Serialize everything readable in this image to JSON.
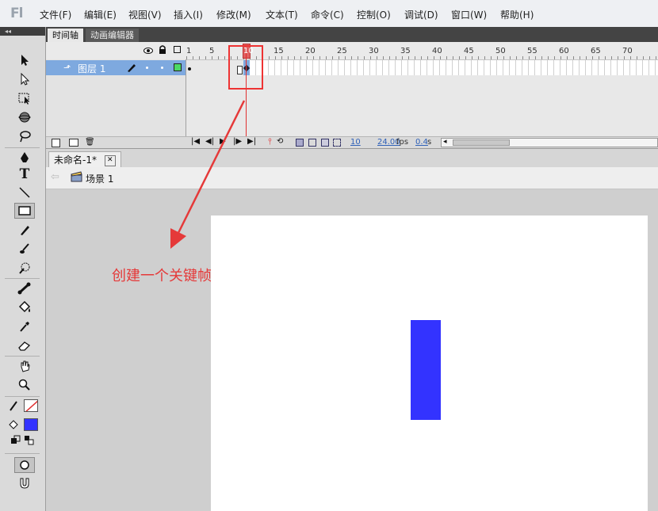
{
  "app": {
    "logo": "Fl"
  },
  "menu": [
    "文件(F)",
    "编辑(E)",
    "视图(V)",
    "插入(I)",
    "修改(M)",
    "文本(T)",
    "命令(C)",
    "控制(O)",
    "调试(D)",
    "窗口(W)",
    "帮助(H)"
  ],
  "panel_tabs": {
    "timeline": "时间轴",
    "motion_editor": "动画编辑器"
  },
  "timeline": {
    "frame_numbers": [
      "1",
      "5",
      "10",
      "15",
      "20",
      "25",
      "30",
      "35",
      "40",
      "45",
      "50",
      "55",
      "60",
      "65",
      "70"
    ],
    "layer_name": "图层 1",
    "current_frame": "10",
    "fps": "24.00",
    "fps_unit": "fps",
    "time": "0.4",
    "time_unit": "s"
  },
  "document": {
    "tab_title": "未命名-1*",
    "scene": "场景 1"
  },
  "annotation": {
    "text": "创建一个关键帧"
  },
  "colors": {
    "shape_fill": "#3333ff",
    "annotation": "#e53939",
    "layer_highlight": "#7ea9df",
    "playhead": "#e03030"
  }
}
